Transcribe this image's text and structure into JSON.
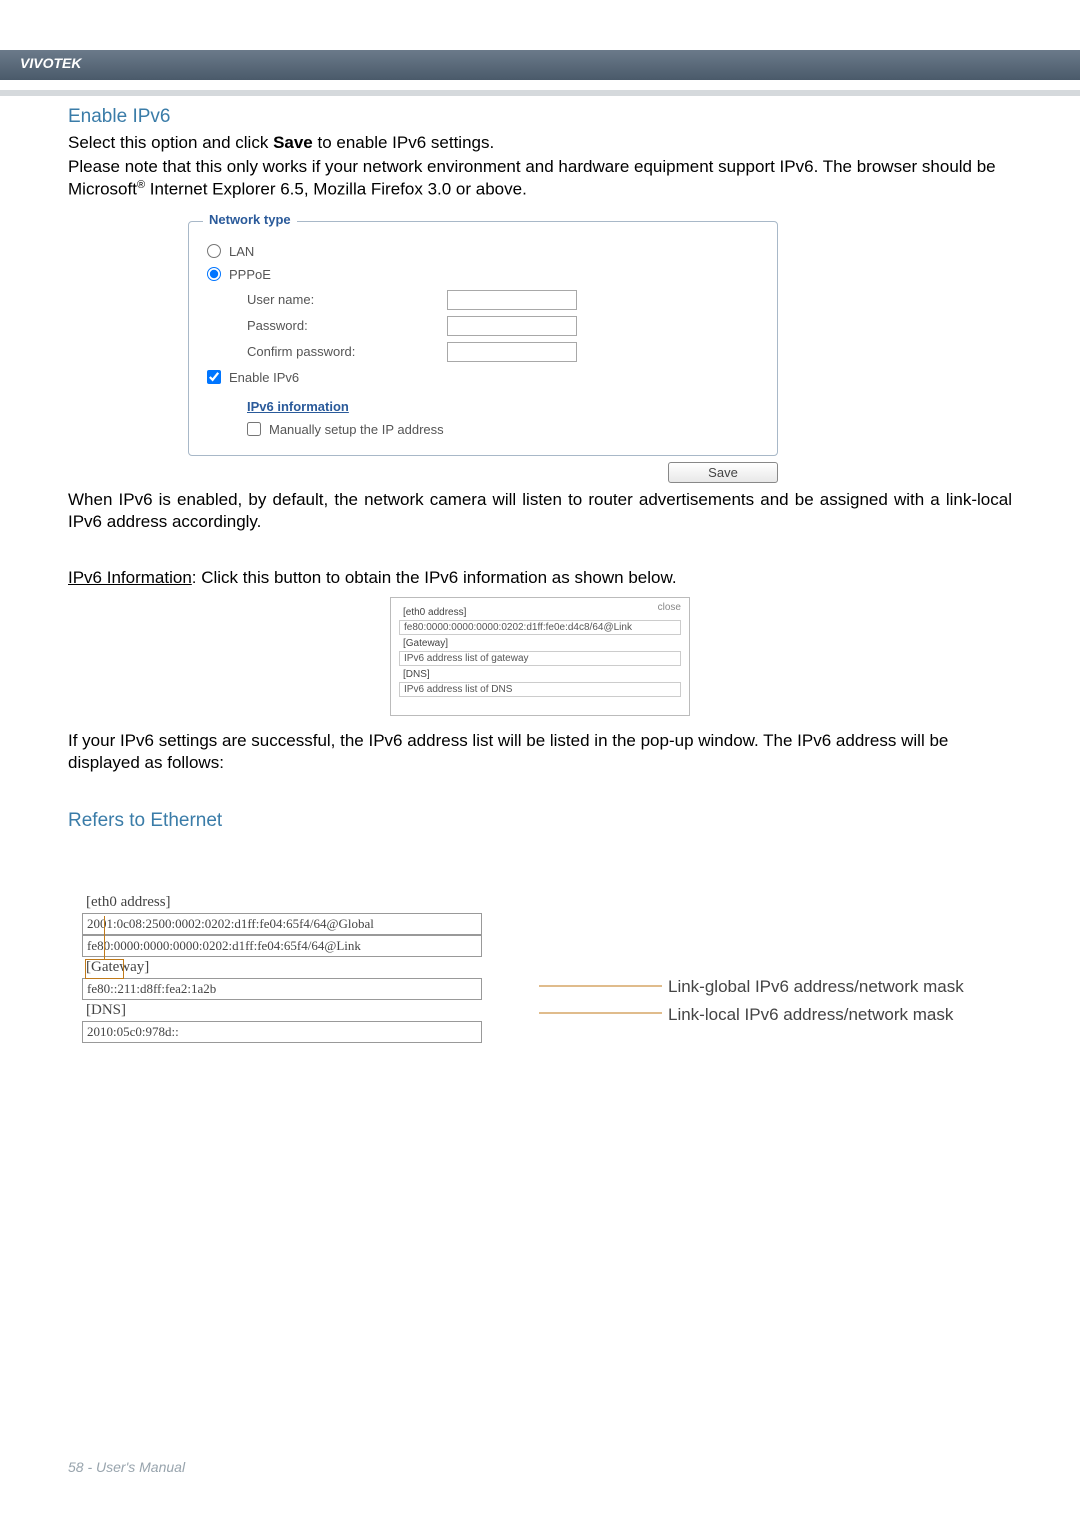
{
  "brand": "VIVOTEK",
  "sectionTitle": "Enable IPv6",
  "intro1_a": "Select this option and click ",
  "intro1_b": "Save",
  "intro1_c": " to enable IPv6 settings.",
  "intro2_a": "Please note that this only works if your network environment and hardware equipment support IPv6. The browser should be Microsoft",
  "intro2_b": " Internet Explorer 6.5, Mozilla Firefox 3.0 or above.",
  "sup": "®",
  "panel": {
    "legend": "Network type",
    "lan": "LAN",
    "pppoe": "PPPoE",
    "username": "User name:",
    "password": "Password:",
    "confirm": "Confirm password:",
    "enable": "Enable IPv6",
    "ipv6info": "IPv6 information",
    "manual": "Manually setup the IP address",
    "save": "Save"
  },
  "afterPanel": "When IPv6 is enabled, by default, the network camera will listen to router advertisements and be assigned with a link-local IPv6 address accordingly.",
  "ipv6infoLabel": "IPv6 Information",
  "ipv6infoText": ": Click this button to obtain the IPv6 information as shown below.",
  "smallPopup": {
    "close": "close",
    "eth0": "[eth0 address]",
    "eth0val": "fe80:0000:0000:0000:0202:d1ff:fe0e:d4c8/64@Link",
    "gw": "[Gateway]",
    "gwval": "IPv6 address list of gateway",
    "dns": "[DNS]",
    "dnsval": "IPv6 address list of DNS"
  },
  "afterPopup": "If your IPv6 settings are successful, the IPv6 address list will be listed in the pop-up window. The IPv6 address will be displayed as follows:",
  "refersTitle": "Refers to Ethernet",
  "bigTable": {
    "eth0": "[eth0 address]",
    "r1": "2001:0c08:2500:0002:0202:d1ff:fe04:65f4/64@Global",
    "r2": "fe80:0000:0000:0000:0202:d1ff:fe04:65f4/64@Link",
    "gw": "[Gateway]",
    "gwv": "fe80::211:d8ff:fea2:1a2b",
    "dns": "[DNS]",
    "dnsv": "2010:05c0:978d::"
  },
  "annot1": "Link-global IPv6 address/network mask",
  "annot2": "Link-local IPv6 address/network mask",
  "footer": "58 - User's Manual"
}
